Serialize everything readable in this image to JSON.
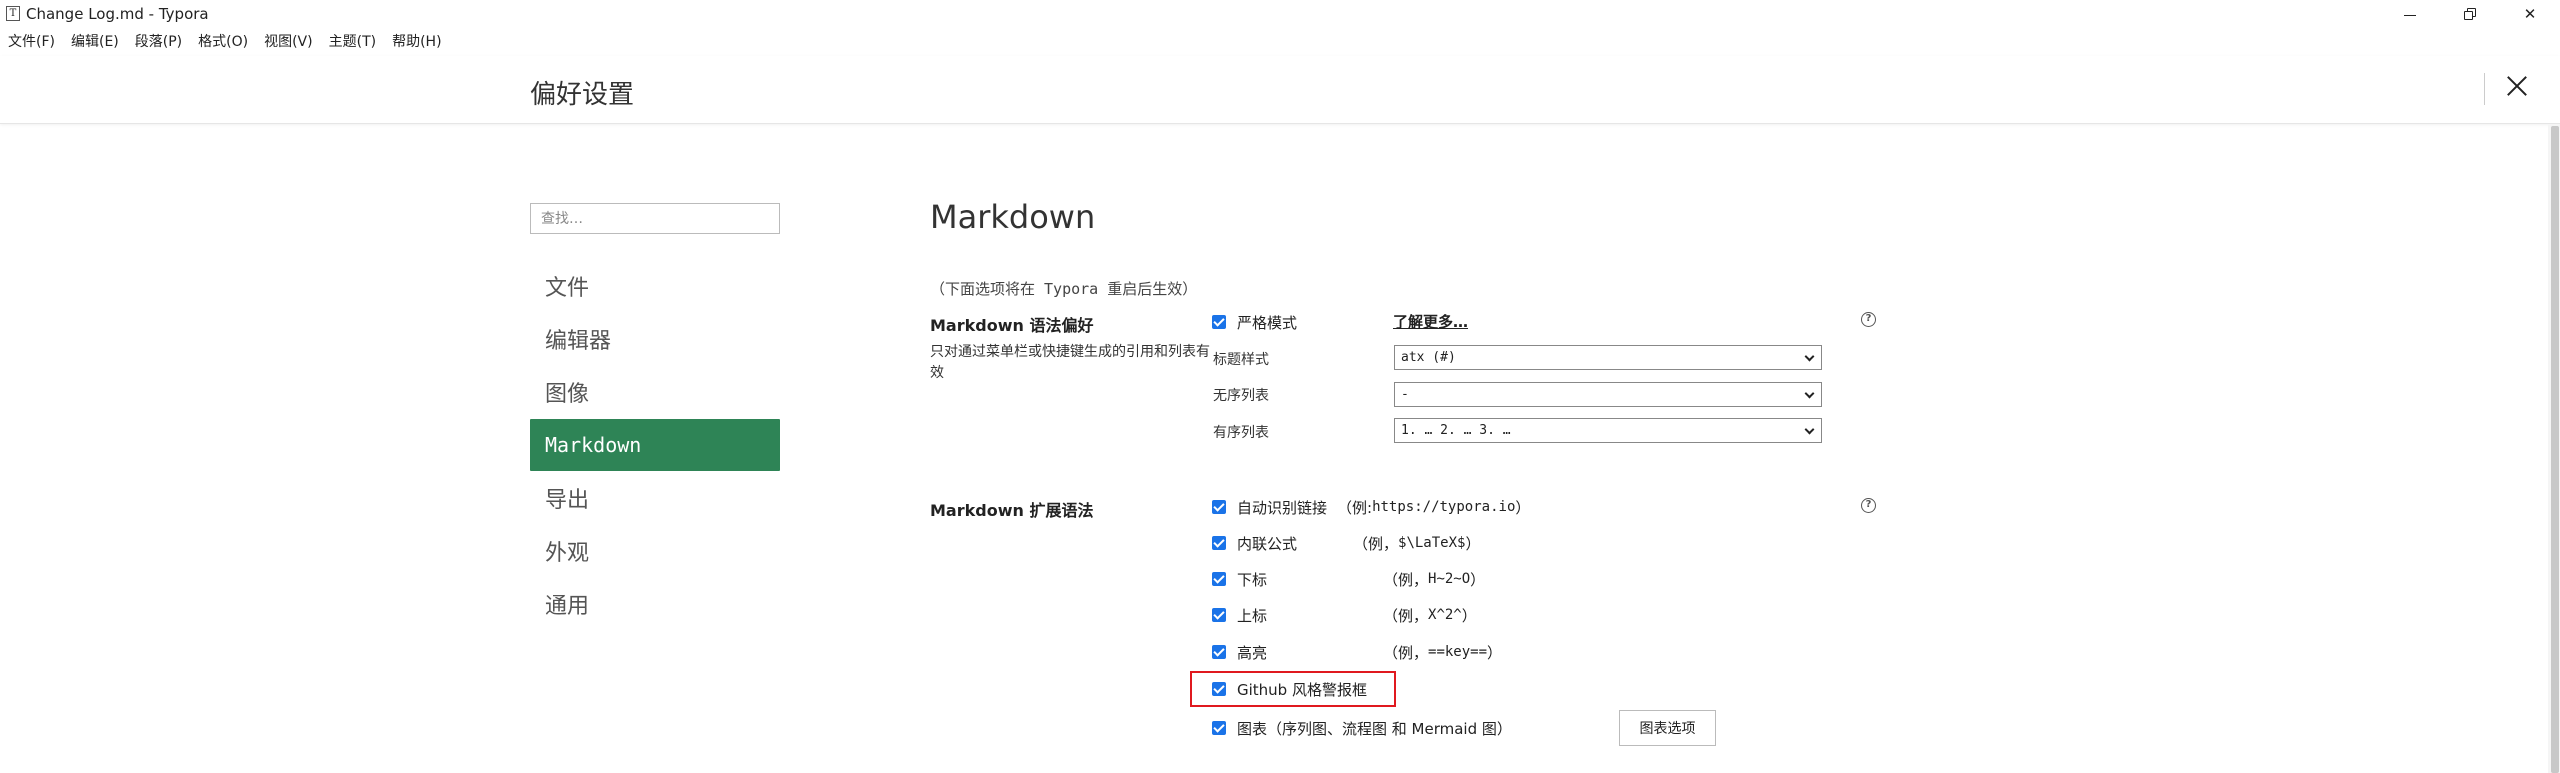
{
  "window": {
    "icon_letter": "T",
    "title": "Change Log.md - Typora",
    "controls": {
      "minimize": "–",
      "maximize": "❐",
      "close": "✕"
    }
  },
  "menubar": [
    "文件(F)",
    "编辑(E)",
    "段落(P)",
    "格式(O)",
    "视图(V)",
    "主题(T)",
    "帮助(H)"
  ],
  "preferences": {
    "title": "偏好设置",
    "search_placeholder": "查找…",
    "nav": [
      {
        "label": "文件",
        "active": false
      },
      {
        "label": "编辑器",
        "active": false
      },
      {
        "label": "图像",
        "active": false
      },
      {
        "label": "Markdown",
        "active": true
      },
      {
        "label": "导出",
        "active": false
      },
      {
        "label": "外观",
        "active": false
      },
      {
        "label": "通用",
        "active": false
      }
    ]
  },
  "main": {
    "title": "Markdown",
    "restart_note": "（下面选项将在 Typora 重启后生效）",
    "syntax_pref": {
      "label": "Markdown 语法偏好",
      "description": "只对通过菜单栏或快捷键生成的引用和列表有效",
      "strict_mode": {
        "label": "严格模式",
        "checked": true
      },
      "learn_more": "了解更多…",
      "heading_style": {
        "label": "标题样式",
        "value": "atx (#)"
      },
      "unordered_list": {
        "label": "无序列表",
        "value": "-"
      },
      "ordered_list": {
        "label": "有序列表",
        "value": "1. … 2. … 3. …"
      }
    },
    "ext_syntax": {
      "label": "Markdown 扩展语法",
      "options": [
        {
          "label": "自动识别链接",
          "example_prefix": "（例: ",
          "example": "https://typora.io",
          "example_suffix": "）",
          "checked": true
        },
        {
          "label": "内联公式",
          "example_prefix": "（例， ",
          "example": "$\\LaTeX$",
          "example_suffix": "）",
          "checked": true
        },
        {
          "label": "下标",
          "example_prefix": "（例， ",
          "example": "H~2~O",
          "example_suffix": "）",
          "checked": true
        },
        {
          "label": "上标",
          "example_prefix": "（例， ",
          "example": "X^2^",
          "example_suffix": "）",
          "checked": true
        },
        {
          "label": "高亮",
          "example_prefix": "（例， ",
          "example": "==key==",
          "example_suffix": "）",
          "checked": true
        },
        {
          "label": "Github 风格警报框",
          "checked": true
        },
        {
          "label": "图表（序列图、流程图 和 Mermaid 图）",
          "checked": true
        }
      ],
      "diagram_button": "图表选项"
    },
    "help_icon": "?"
  },
  "colors": {
    "accent_green": "#2e8456",
    "checkbox_blue": "#1a73e8",
    "highlight_red": "#e0191f"
  }
}
